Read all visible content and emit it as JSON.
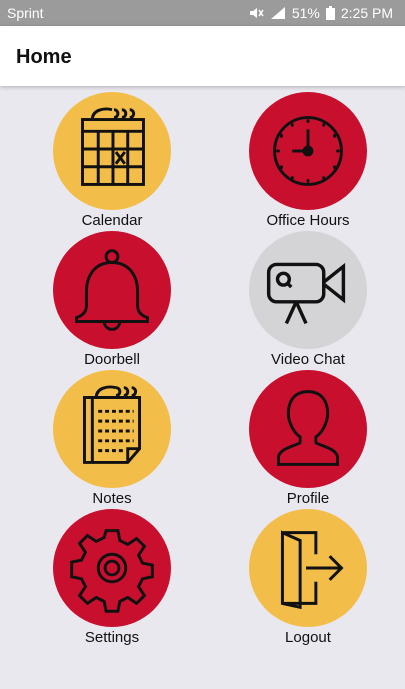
{
  "status_bar": {
    "carrier": "Sprint",
    "battery": "51%",
    "time": "2:25 PM"
  },
  "header": {
    "title": "Home"
  },
  "colors": {
    "yellow": "#f3bd4a",
    "red": "#c8102e",
    "gray": "#d4d4d6"
  },
  "tiles": [
    {
      "label": "Calendar",
      "icon": "calendar-icon",
      "color": "yellow"
    },
    {
      "label": "Office Hours",
      "icon": "clock-icon",
      "color": "red"
    },
    {
      "label": "Doorbell",
      "icon": "bell-icon",
      "color": "red"
    },
    {
      "label": "Video Chat",
      "icon": "video-camera-icon",
      "color": "gray"
    },
    {
      "label": "Notes",
      "icon": "notepad-icon",
      "color": "yellow"
    },
    {
      "label": "Profile",
      "icon": "person-icon",
      "color": "red"
    },
    {
      "label": "Settings",
      "icon": "gear-icon",
      "color": "red"
    },
    {
      "label": "Logout",
      "icon": "logout-door-icon",
      "color": "yellow"
    }
  ]
}
